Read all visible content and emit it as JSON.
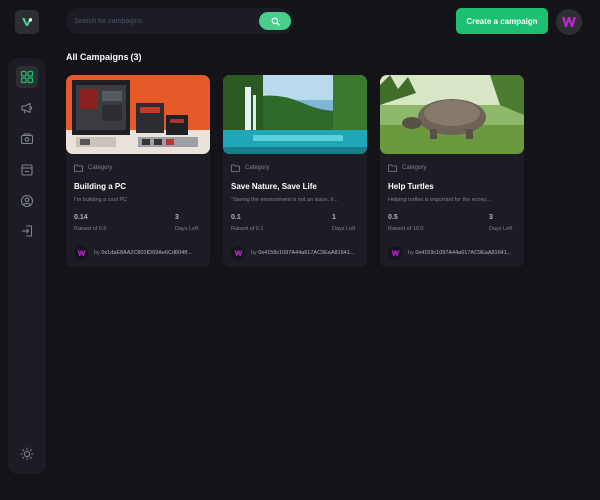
{
  "app": {
    "accent": "#1dc071",
    "search_button_color": "#4acd8d"
  },
  "sidebar": {
    "items": [
      {
        "icon": "dashboard-icon",
        "active": true
      },
      {
        "icon": "megaphone-icon",
        "active": false
      },
      {
        "icon": "payment-icon",
        "active": false
      },
      {
        "icon": "withdraw-icon",
        "active": false
      },
      {
        "icon": "profile-icon",
        "active": false
      },
      {
        "icon": "logout-icon",
        "active": false
      }
    ],
    "theme_toggle_icon": "sun-icon"
  },
  "header": {
    "search_placeholder": "Search for campaigns",
    "create_label": "Create a campaign"
  },
  "main": {
    "title": "All Campaigns",
    "count": "(3)"
  },
  "campaigns": [
    {
      "category": "Category",
      "title": "Building a PC",
      "description": "I'm building a cool PC",
      "raised": "0.14",
      "raised_label": "Raised of 0.5",
      "days": "3",
      "days_label": "Days Left",
      "owner_prefix": "by",
      "owner": "0x1daE8AA2C801fD69Ae6Cd604ff..."
    },
    {
      "category": "Category",
      "title": "Save Nature, Save Life",
      "description": "\"Saving the environment is not an issue, it...",
      "raised": "0.1",
      "raised_label": "Raised of 0.1",
      "days": "1",
      "days_label": "Days Left",
      "owner_prefix": "by",
      "owner": "0x4159c1097A44a617AC9EaA81641..."
    },
    {
      "category": "Category",
      "title": "Help Turtles",
      "description": "Helping turtles is important for the ecosy...",
      "raised": "0.5",
      "raised_label": "Raised of 10.0",
      "days": "3",
      "days_label": "Days Left",
      "owner_prefix": "by",
      "owner": "0x4159c1097A44a617AC9EaA81641..."
    }
  ]
}
